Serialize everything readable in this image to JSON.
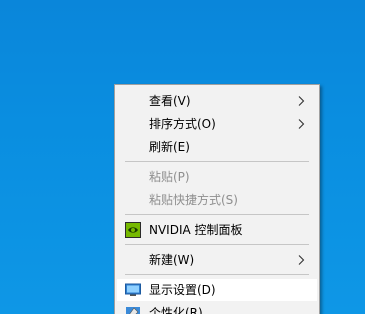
{
  "desktop": {
    "background_color": "#0a8ee0"
  },
  "context_menu": {
    "items": [
      {
        "label": "查看(V)",
        "enabled": true,
        "submenu": true
      },
      {
        "label": "排序方式(O)",
        "enabled": true,
        "submenu": true
      },
      {
        "label": "刷新(E)",
        "enabled": true,
        "submenu": false
      },
      {
        "label": "粘贴(P)",
        "enabled": false,
        "submenu": false
      },
      {
        "label": "粘贴快捷方式(S)",
        "enabled": false,
        "submenu": false
      },
      {
        "label": "NVIDIA 控制面板",
        "enabled": true,
        "submenu": false,
        "icon": "nvidia-icon"
      },
      {
        "label": "新建(W)",
        "enabled": true,
        "submenu": true
      },
      {
        "label": "显示设置(D)",
        "enabled": true,
        "submenu": false,
        "icon": "display-icon",
        "highlighted": true
      },
      {
        "label": "个性化(R)",
        "enabled": true,
        "submenu": false,
        "icon": "personalize-icon"
      }
    ]
  }
}
